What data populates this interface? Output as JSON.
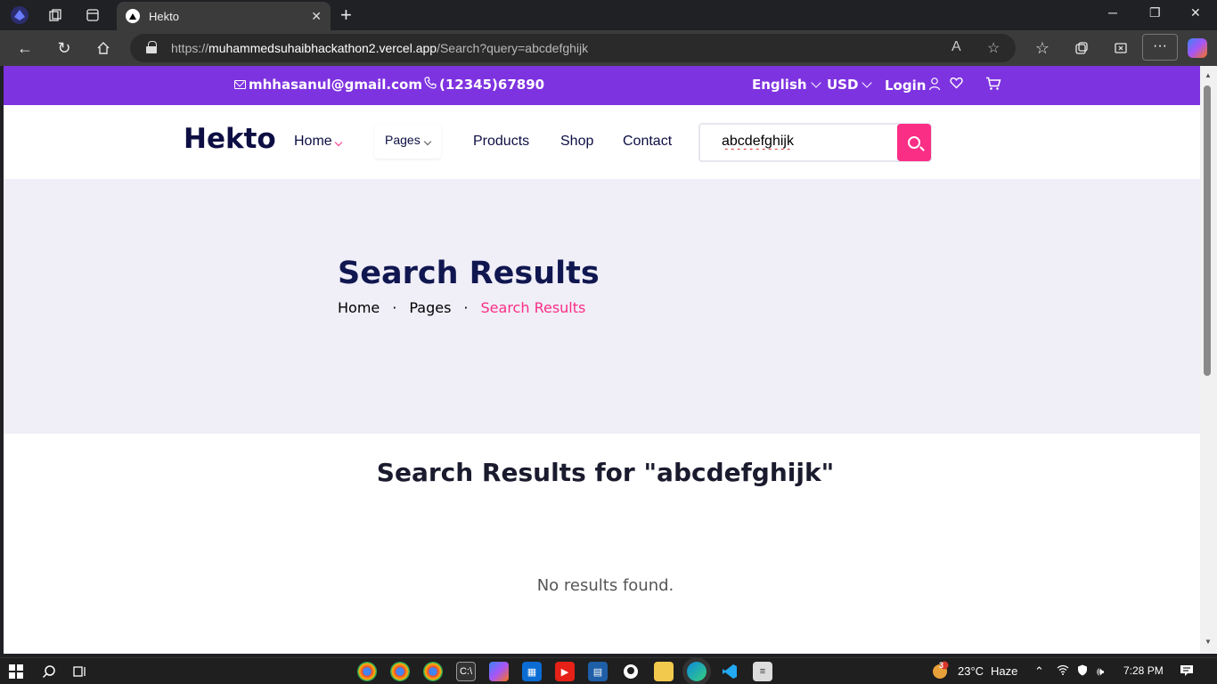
{
  "browser": {
    "tab_title": "Hekto",
    "url_prefix": "https://",
    "url_host": "muhammedsuhaibhackathon2.vercel.app",
    "url_path": "/Search?query=abcdefghijk"
  },
  "topbar": {
    "email": "mhhasanul@gmail.com",
    "phone": "(12345)67890",
    "language": "English",
    "currency": "USD",
    "login": "Login"
  },
  "nav": {
    "logo": "Hekto",
    "home": "Home",
    "pages": "Pages",
    "products": "Products",
    "shop": "Shop",
    "contact": "Contact",
    "search_value": "abcdefghijk"
  },
  "hero": {
    "title": "Search Results",
    "breadcrumb": [
      "Home",
      "Pages",
      "Search Results"
    ]
  },
  "results": {
    "heading": "Search Results for \"abcdefghijk\"",
    "empty": "No results found."
  },
  "taskbar": {
    "weather": "23°C",
    "condition": "Haze",
    "time": "7:28 PM",
    "weather_badge": "3"
  },
  "colors": {
    "topbar": "#7e33e0",
    "accent": "#fb2e86",
    "navy": "#0d0e43",
    "hero_bg": "#f0eef7"
  }
}
